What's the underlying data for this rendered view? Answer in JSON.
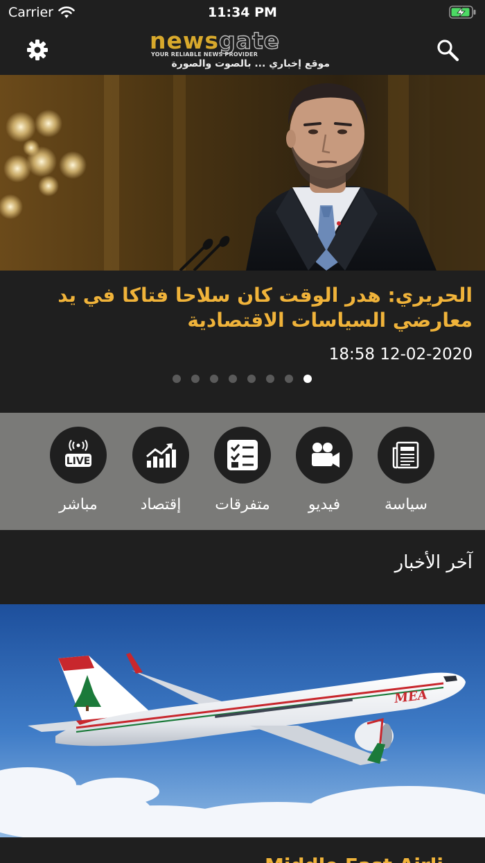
{
  "status_bar": {
    "carrier": "Carrier",
    "time": "11:34 PM"
  },
  "header": {
    "logo_part1": "news",
    "logo_part2": "gate",
    "logo_tagline": "YOUR RELIABLE NEWS PROVIDER",
    "logo_arabic": "موقع إخباري ... بالصوت والصورة"
  },
  "hero": {
    "title": "الحريري: هدر الوقت كان سلاحا فتاكا في يد معارضي السياسات الاقتصادية",
    "date": "18:58 12-02-2020",
    "page_count": 8,
    "active_page": 8
  },
  "categories": [
    {
      "label": "سياسة",
      "icon": "newspaper-icon"
    },
    {
      "label": "فيديو",
      "icon": "video-camera-icon"
    },
    {
      "label": "متفرقات",
      "icon": "checklist-icon"
    },
    {
      "label": "إقتصاد",
      "icon": "chart-icon"
    },
    {
      "label": "مباشر",
      "icon": "live-icon"
    }
  ],
  "latest": {
    "title": "آخر الأخبار",
    "first_item_caption": "Middle East Airli"
  },
  "colors": {
    "background": "#1f1f1f",
    "accent": "#f0b33a",
    "category_bar": "#7a7a78",
    "logo_gold": "#d8a92c"
  }
}
